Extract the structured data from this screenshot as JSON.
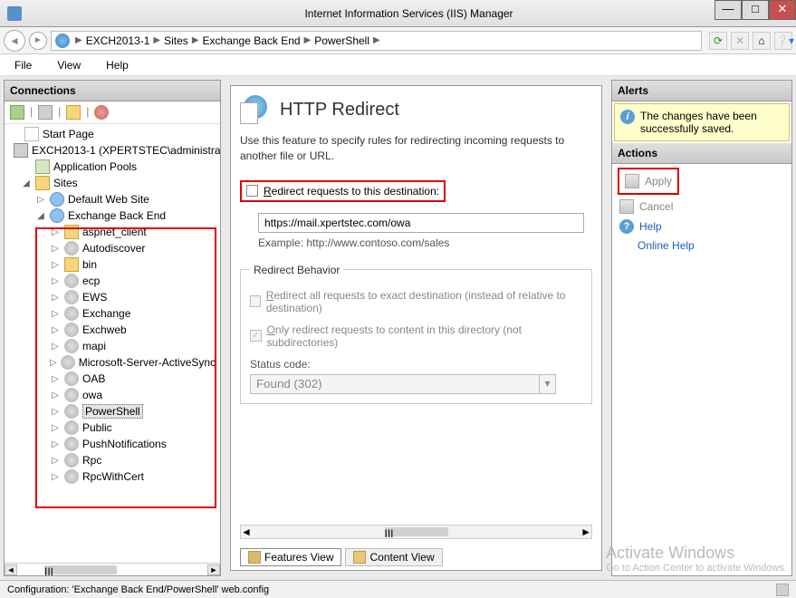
{
  "window": {
    "title": "Internet Information Services (IIS) Manager"
  },
  "breadcrumb": [
    "EXCH2013-1",
    "Sites",
    "Exchange Back End",
    "PowerShell"
  ],
  "menu": {
    "file": "File",
    "view": "View",
    "help": "Help"
  },
  "connections": {
    "header": "Connections",
    "start_page": "Start Page",
    "server": "EXCH2013-1 (XPERTSTEC\\administrator)",
    "app_pools": "Application Pools",
    "sites": "Sites",
    "default_site": "Default Web Site",
    "back_end": "Exchange Back End",
    "children": [
      "aspnet_client",
      "Autodiscover",
      "bin",
      "ecp",
      "EWS",
      "Exchange",
      "Exchweb",
      "mapi",
      "Microsoft-Server-ActiveSync",
      "OAB",
      "owa",
      "PowerShell",
      "Public",
      "PushNotifications",
      "Rpc",
      "RpcWithCert"
    ]
  },
  "feature": {
    "title": "HTTP Redirect",
    "desc": "Use this feature to specify rules for redirecting incoming requests to another file or URL.",
    "redirect_label_pre": "R",
    "redirect_label": "edirect requests to this destination:",
    "url": "https://mail.xpertstec.com/owa",
    "example": "Example: http://www.contoso.com/sales",
    "behavior_legend": "Redirect Behavior",
    "exact_pre": "R",
    "exact_label": "edirect all requests to exact destination (instead of relative to destination)",
    "only_pre": "O",
    "only_label": "nly redirect requests to content in this directory (not subdirectories)",
    "status_label": "Status code:",
    "status_value": "Found (302)"
  },
  "views": {
    "features": "Features View",
    "content": "Content View"
  },
  "alerts": {
    "header": "Alerts",
    "saved": "The changes have been successfully saved."
  },
  "actions": {
    "header": "Actions",
    "apply": "Apply",
    "cancel": "Cancel",
    "help": "Help",
    "online_help": "Online Help"
  },
  "watermark": {
    "t1": "Activate Windows",
    "t2": "Go to Action Center to activate Windows."
  },
  "status_bar": "Configuration: 'Exchange Back End/PowerShell' web.config",
  "scroll_mark": "III"
}
